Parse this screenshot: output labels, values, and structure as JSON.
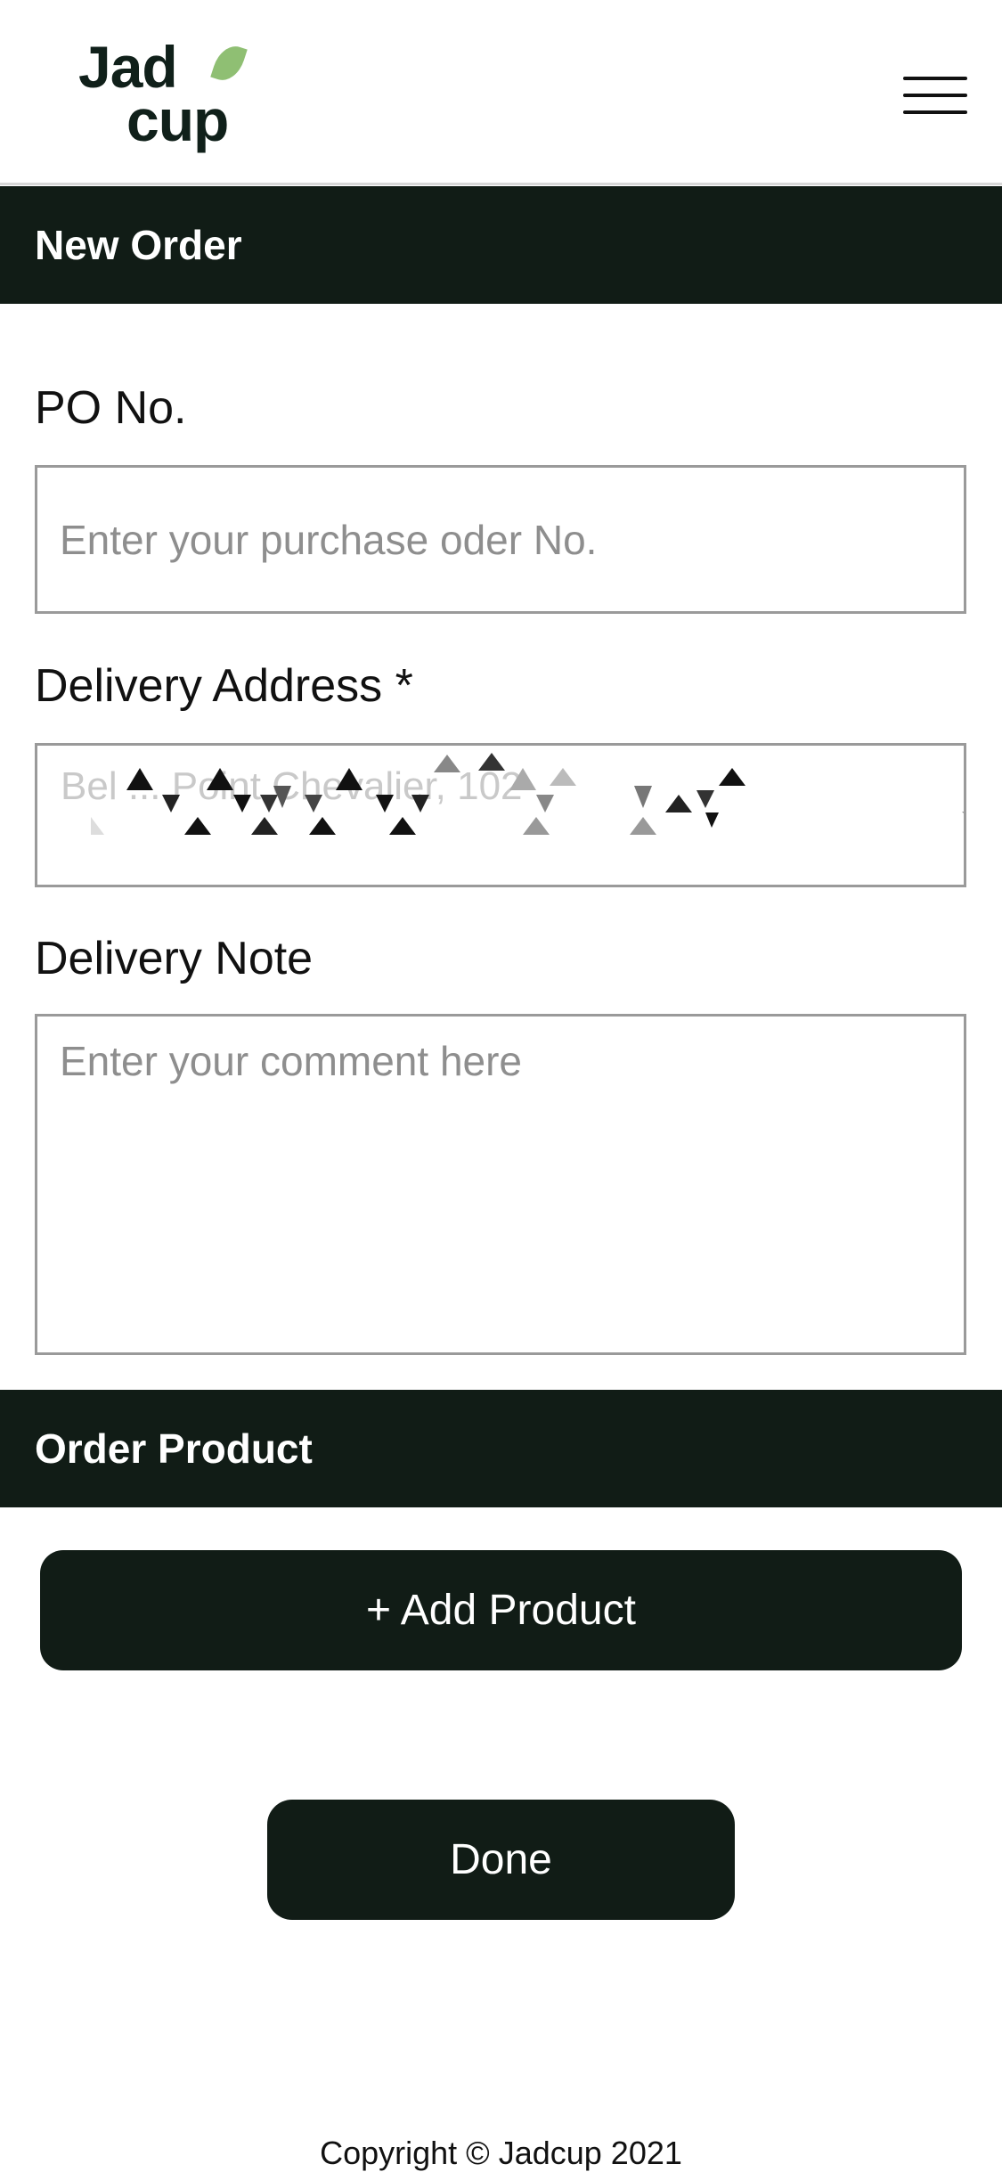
{
  "header": {
    "logo_line1": "Jad",
    "logo_line2": "cup",
    "menu_icon": "hamburger-menu-icon"
  },
  "sections": {
    "new_order": "New Order",
    "order_product": "Order Product"
  },
  "form": {
    "po_label": "PO No.",
    "po_placeholder": "Enter your purchase oder No.",
    "address_label": "Delivery Address *",
    "address_value": "Bel ... Point Chevalier, 102",
    "note_label": "Delivery Note",
    "note_placeholder": "Enter your comment here"
  },
  "actions": {
    "add_product": "+ Add Product",
    "done": "Done"
  },
  "footer": {
    "copyright": "Copyright © Jadcup 2021"
  },
  "colors": {
    "brand_dark": "#111c16",
    "leaf_green": "#8fbf73",
    "field_border": "#9a9a9a"
  }
}
